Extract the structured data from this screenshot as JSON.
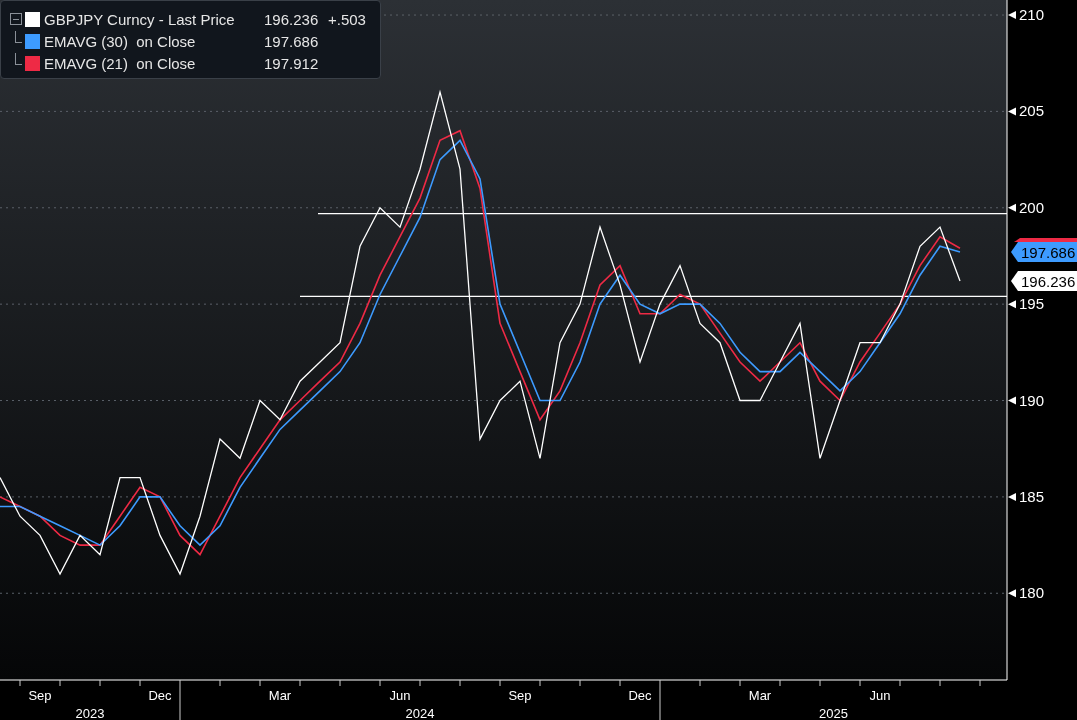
{
  "legend": {
    "expanded": true,
    "entries": [
      {
        "value": "196.236",
        "change": "+.503"
      },
      {
        "suffix": "  on Close",
        "value": "197.686"
      },
      {
        "suffix": "  on Close",
        "value": "197.912"
      }
    ]
  },
  "price_tags": [
    {
      "color": "#ee2a45"
    },
    {
      "text": "197.686",
      "color": "#3d9bff"
    },
    {
      "text": "196.236",
      "color": "#ffffff"
    }
  ],
  "chart_data": {
    "type": "line",
    "ylim": [
      175.5,
      210.78
    ],
    "categories": [
      null,
      null,
      "Sep",
      null,
      null,
      null,
      null,
      null,
      "Dec",
      null,
      null,
      null,
      null,
      null,
      "Mar",
      null,
      null,
      null,
      null,
      null,
      "Jun",
      null,
      null,
      null,
      null,
      null,
      "Sep",
      null,
      null,
      null,
      null,
      null,
      "Dec",
      null,
      null,
      null,
      null,
      null,
      "Mar",
      null,
      null,
      null,
      null,
      null,
      "Jun",
      null,
      null,
      null,
      null
    ],
    "series": [
      {
        "name": "GBPJPY Curncy - Last Price",
        "color": "#ffffff",
        "values": [
          186,
          184,
          183,
          181,
          183,
          182,
          186,
          186,
          183,
          181,
          184,
          188,
          187,
          190,
          189,
          191,
          192,
          193,
          198,
          200,
          199,
          202,
          206,
          202,
          188,
          190,
          191,
          187,
          193,
          195,
          199,
          196,
          192,
          195,
          197,
          194,
          193,
          190,
          190,
          192,
          194,
          187,
          190,
          193,
          193,
          195,
          198,
          199,
          196.2
        ]
      },
      {
        "name": "EMAVG (30)",
        "color": "#3d9bff",
        "values": [
          184.5,
          184.5,
          184,
          183.5,
          183,
          182.5,
          183.5,
          185,
          185,
          183.5,
          182.5,
          183.5,
          185.5,
          187,
          188.5,
          189.5,
          190.5,
          191.5,
          193,
          195.5,
          197.5,
          199.5,
          202.5,
          203.5,
          201.5,
          195,
          192.5,
          190,
          190,
          192,
          195,
          196.5,
          195,
          194.5,
          195,
          195,
          194,
          192.5,
          191.5,
          191.5,
          192.5,
          191.5,
          190.5,
          191.5,
          193,
          194.5,
          196.5,
          198,
          197.7
        ]
      },
      {
        "name": "EMAVG (21)",
        "color": "#ee2a45",
        "values": [
          185,
          184.5,
          184,
          183,
          182.5,
          182.5,
          184,
          185.5,
          185,
          183,
          182,
          184,
          186,
          187.5,
          189,
          190,
          191,
          192,
          194,
          196.5,
          198.5,
          200.5,
          203.5,
          204,
          201,
          194,
          191.5,
          189,
          190.5,
          193,
          196,
          197,
          194.5,
          194.5,
          195.5,
          195,
          193.5,
          192,
          191,
          192,
          193,
          191,
          190,
          192,
          193.5,
          195,
          197,
          198.5,
          197.9
        ]
      }
    ],
    "yticks": [
      180,
      185,
      190,
      195,
      200,
      205,
      210
    ],
    "grid": true,
    "ref_lines": [
      {
        "axis": "y",
        "value": 199.7
      },
      {
        "axis": "y",
        "value": 195.4
      }
    ]
  },
  "year_bands": [
    {
      "label": "2023"
    },
    {
      "label": "2024"
    },
    {
      "label": "2025"
    }
  ]
}
